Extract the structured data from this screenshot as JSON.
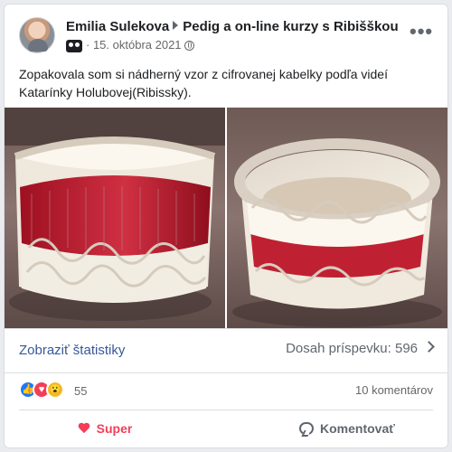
{
  "post": {
    "author": "Emilia Sulekova",
    "group": "Pedig a on-line kurzy s Ribišškou",
    "date": "15. októbra 2021",
    "text": "Zopakovala som si nádherný vzor z cifrovanej kabelky podľa videí Katarínky Holubovej(Ribissky)."
  },
  "insights": {
    "stats_label": "Zobraziť štatistiky",
    "reach_label": "Dosah príspevku: 596"
  },
  "reactions": {
    "count": "55",
    "comments": "10 komentárov"
  },
  "actions": {
    "super_label": "Super",
    "comment_label": "Komentovať"
  },
  "colors": {
    "link": "#385898",
    "love": "#f33e58",
    "like": "#2078f4",
    "wow": "#f7b928"
  }
}
